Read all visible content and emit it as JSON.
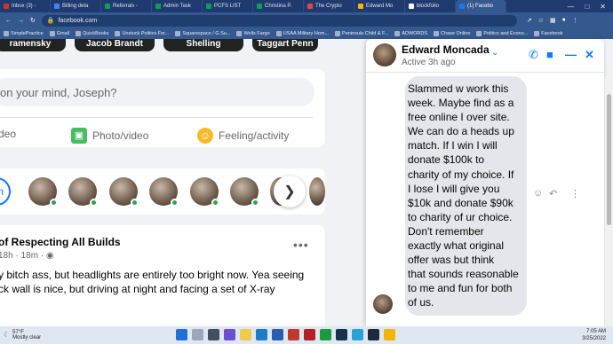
{
  "browser": {
    "tabs": [
      {
        "label": "Inbox (3) -",
        "color": "#d93025"
      },
      {
        "label": "Billing deta",
        "color": "#4285f4"
      },
      {
        "label": "Referrals - ",
        "color": "#0f9d58"
      },
      {
        "label": "Admin Task",
        "color": "#0f9d58"
      },
      {
        "label": "PCFS LIST",
        "color": "#0f9d58"
      },
      {
        "label": "Christina P.",
        "color": "#0f9d58"
      },
      {
        "label": "The Crypto",
        "color": "#e8453c"
      },
      {
        "label": "Edward Mo",
        "color": "#f4b400"
      },
      {
        "label": "blockfolio",
        "color": "#ffffff"
      },
      {
        "label": "(1) Facebo",
        "color": "#1877f2"
      }
    ],
    "url": "facebook.com",
    "bookmarks": [
      "SimplePractice",
      "Gmail",
      "QuickBooks",
      "Unstuck Politics For...",
      "Squarespace / G Su...",
      "Wells Fargo",
      "USAA Military Hom...",
      "Peninsula Child & F...",
      "ADWORDS",
      "Chase Online",
      "Politics and Econo...",
      "Facebook"
    ]
  },
  "feed": {
    "story_names": [
      "ramensky",
      "Jacob Brandt",
      "Shelling",
      "Taggart Penn"
    ],
    "composer": {
      "placeholder": "on your mind, Joseph?",
      "video_label": "deo",
      "photo_label": "Photo/video",
      "feeling_label": "Feeling/activity"
    },
    "rooms_left_label": "n",
    "post": {
      "title": "of Respecting All Builds",
      "meta": "18h · 18m ·",
      "more": "•••",
      "lines": [
        "y bitch ass, but headlights are entirely too bright now. Yea seeing",
        "ck wall is nice, but driving at night and facing a set of X-ray"
      ]
    }
  },
  "chat": {
    "name": "Edward Moncada",
    "status": "Active 3h ago",
    "message_lines": [
      "Slammed w work this",
      "week.  Maybe find as a",
      "free online I over site.",
      "We can do a heads up",
      "match.  If I win I will",
      "donate $100k to",
      "charity of my choice.  If",
      "I lose I will give you",
      "$10k and donate $90k",
      "to charity of ur choice.",
      "Don't remember",
      "exactly what original",
      "offer was but think",
      "that sounds reasonable",
      "to me and fun for both",
      "of us."
    ]
  },
  "taskbar": {
    "temp": "57°F",
    "weather": "Mostly clear",
    "time": "7:05 AM",
    "date": "3/25/2022"
  },
  "colors": {
    "facebook_blue": "#0a7cff",
    "online_green": "#31a24c",
    "chrome_dark": "#1e3a6e"
  }
}
